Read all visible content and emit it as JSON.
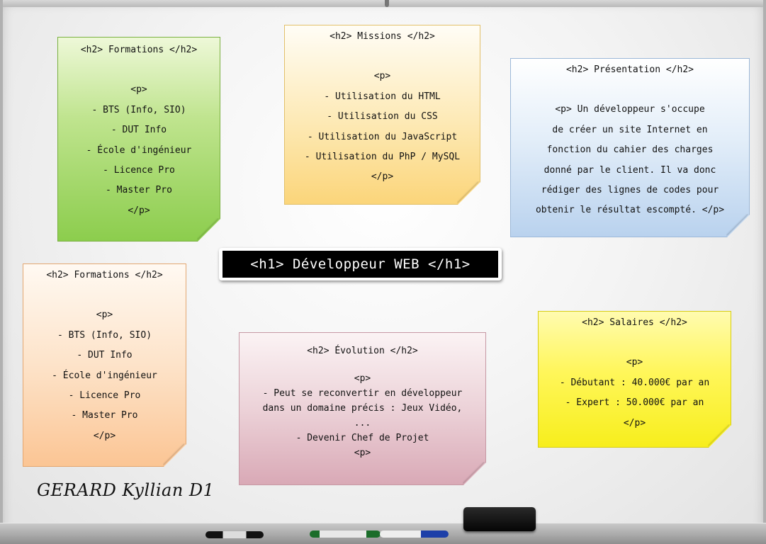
{
  "title": "<h1> Développeur WEB </h1>",
  "signature": "GERARD Kyllian D1",
  "notes": {
    "formations_green": {
      "heading": "<h2> Formations </h2>",
      "lines": [
        "<p>",
        "- BTS (Info, SIO)",
        "- DUT Info",
        "- École d'ingénieur",
        "- Licence Pro",
        "- Master Pro",
        "</p>"
      ]
    },
    "missions": {
      "heading": "<h2> Missions </h2>",
      "lines": [
        "<p>",
        "- Utilisation du HTML",
        "- Utilisation du CSS",
        "- Utilisation du JavaScript",
        "- Utilisation du PhP / MySQL",
        "</p>"
      ]
    },
    "presentation": {
      "heading": "<h2> Présentation </h2>",
      "lines": [
        "<p> Un développeur s'occupe",
        "de créer un site Internet en",
        "fonction du cahier des charges",
        "donné par le client. Il va donc",
        "rédiger des lignes de codes pour",
        "obtenir le résultat escompté. </p>"
      ]
    },
    "formations_orange": {
      "heading": "<h2> Formations </h2>",
      "lines": [
        "<p>",
        "- BTS (Info, SIO)",
        "- DUT Info",
        "- École d'ingénieur",
        "- Licence Pro",
        "- Master Pro",
        "</p>"
      ]
    },
    "evolution": {
      "heading": "<h2> Évolution </h2>",
      "lines": [
        "<p>",
        "- Peut se reconvertir en développeur",
        "dans un domaine précis : Jeux Vidéo,",
        "...",
        "- Devenir Chef de Projet",
        "<p>"
      ]
    },
    "salaires": {
      "heading": "<h2> Salaires </h2>",
      "lines": [
        "<p>",
        "- Débutant : 40.000€ par an",
        "- Expert : 50.000€ par an",
        "</p>"
      ]
    }
  },
  "colors": {
    "green": "#8ccd4d",
    "yellow_light": "#fbd57a",
    "blue": "#b9d2ee",
    "orange": "#fbc594",
    "pink": "#d9a9b6",
    "yellow_bright": "#f7ee1c"
  }
}
